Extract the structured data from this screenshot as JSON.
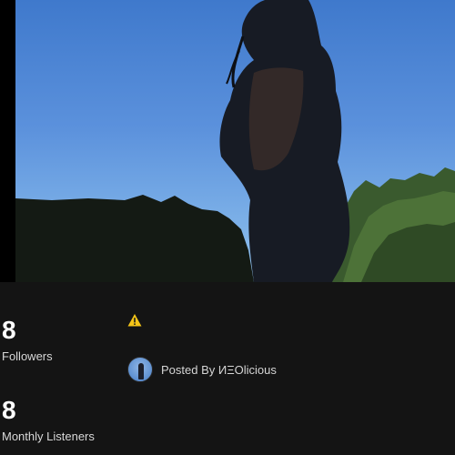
{
  "stats": {
    "followers_value": "8",
    "followers_label": "Followers",
    "listeners_value": "8",
    "listeners_label": "Monthly Listeners"
  },
  "post": {
    "posted_by_text": "Posted By ИΞOlicious"
  },
  "icons": {
    "warning": "warning-icon"
  },
  "colors": {
    "background": "#141414",
    "warning": "#f5c518",
    "sky": "#5b91dc"
  }
}
